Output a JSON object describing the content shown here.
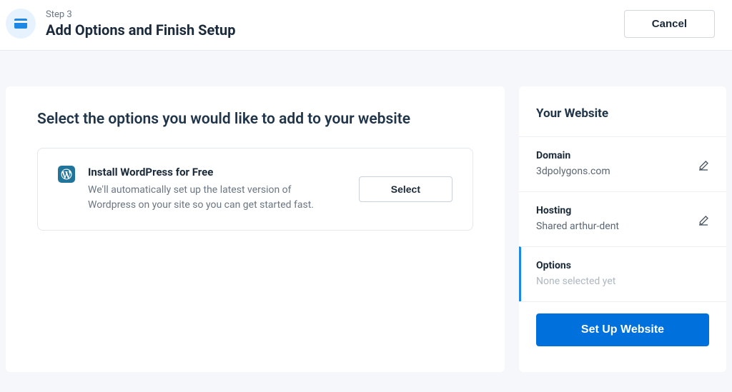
{
  "header": {
    "step_label": "Step 3",
    "step_title": "Add Options and Finish Setup",
    "cancel": "Cancel"
  },
  "main": {
    "heading": "Select the options you would like to add to your website",
    "option": {
      "title": "Install WordPress for Free",
      "description": "We'll automatically set up the latest version of Wordpress on your site so you can get started fast.",
      "select_label": "Select"
    }
  },
  "sidebar": {
    "title": "Your Website",
    "domain": {
      "label": "Domain",
      "value": "3dpolygons.com"
    },
    "hosting": {
      "label": "Hosting",
      "value": "Shared arthur-dent"
    },
    "options": {
      "label": "Options",
      "value": "None selected yet"
    },
    "cta": "Set Up Website"
  }
}
